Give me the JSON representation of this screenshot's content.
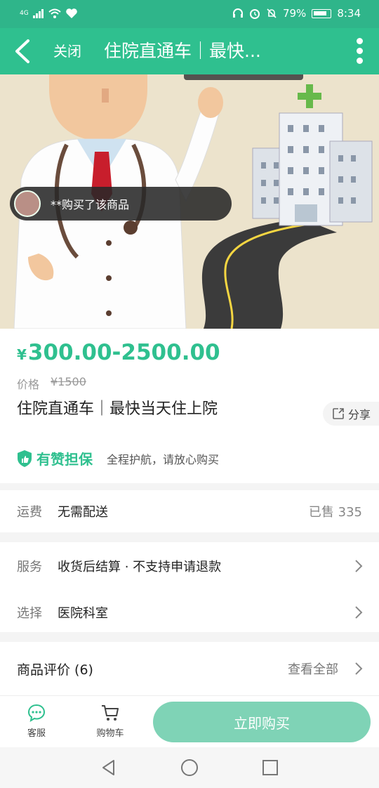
{
  "status_bar": {
    "network": "4G",
    "battery_percent": "79%",
    "time": "8:34"
  },
  "titlebar": {
    "close_label": "关闭",
    "title": "住院直通车｜最快..."
  },
  "hero": {
    "buyer_notice": "**购买了该商品"
  },
  "product": {
    "price_yen": "¥",
    "price_range": "300.00-2500.00",
    "original_label": "价格",
    "original_price": "¥1500",
    "title": "住院直通车｜最快当天住上院",
    "share_label": "分享",
    "guarantee_title": "有赞担保",
    "guarantee_subtitle": "全程护航，请放心购买"
  },
  "shipping": {
    "label": "运费",
    "value": "无需配送",
    "sold": "已售 335"
  },
  "service": {
    "label": "服务",
    "value": "收货后结算 · 不支持申请退款"
  },
  "select": {
    "label": "选择",
    "value": "医院科室"
  },
  "reviews": {
    "title": "商品评价 (6)",
    "link": "查看全部"
  },
  "bottom": {
    "service_label": "客服",
    "cart_label": "购物车",
    "buy_label": "立即购买"
  },
  "colors": {
    "brand": "#2fc08f",
    "buy_button": "#7fd3b6"
  }
}
